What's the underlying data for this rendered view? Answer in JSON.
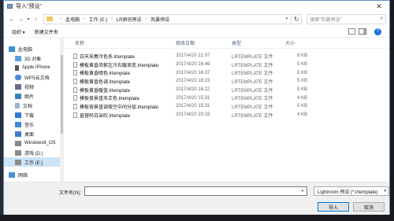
{
  "window": {
    "title": "导入\"预设\"",
    "close_glyph": "✕"
  },
  "address": {
    "crumbs": [
      "此电脑",
      "工作 (E:)",
      "LR原创预设",
      "风暴预设"
    ],
    "search_placeholder": "搜索\"风暴预设\""
  },
  "toolbar": {
    "organize": "组织 ▾",
    "new_folder": "新建文件夹"
  },
  "sidebar": {
    "items": [
      {
        "label": "此电脑"
      },
      {
        "label": "3D 对象"
      },
      {
        "label": "Apple iPhone"
      },
      {
        "label": "WPS云文档"
      },
      {
        "label": "视频"
      },
      {
        "label": "图片"
      },
      {
        "label": "文档"
      },
      {
        "label": "下载"
      },
      {
        "label": "音乐"
      },
      {
        "label": "桌面"
      },
      {
        "label": "Windows8_OS"
      },
      {
        "label": "游戏 (D:)"
      },
      {
        "label": "工作 (E:)"
      },
      {
        "label": "网络"
      }
    ]
  },
  "columns": {
    "name": "名称",
    "date": "修改日期",
    "type": "类型",
    "size": "大小"
  },
  "files": [
    {
      "name": "白天采春冷色系.lrtemplate",
      "date": "2017/4/20 21:07",
      "type": "LRTEMPLATE 文件",
      "size": "8 KB"
    },
    {
      "name": "模板黄昏浓郁左冷右暖渐变.lrtemplate",
      "date": "2017/4/20 16:49",
      "type": "LRTEMPLATE 文件",
      "size": "5 KB"
    },
    {
      "name": "模板黄昏暗色.lrtemplate",
      "date": "2017/4/20 16:37",
      "type": "LRTEMPLATE 文件",
      "size": "5 KB"
    },
    {
      "name": "模板黄昏色调.lrtemplate",
      "date": "2017/4/20 16:23",
      "type": "LRTEMPLATE 文件",
      "size": "5 KB"
    },
    {
      "name": "模板黄昏暖蓝.lrtemplate",
      "date": "2017/4/20 16:22",
      "type": "LRTEMPLATE 文件",
      "size": "5 KB"
    },
    {
      "name": "模板夜景蓝天正色.lrtemplate",
      "date": "2017/4/20 15:31",
      "type": "LRTEMPLATE 文件",
      "size": "4 KB"
    },
    {
      "name": "模板夜景蓝调夜空中间分层.lrtemplate",
      "date": "2017/4/20 15:31",
      "type": "LRTEMPLATE 文件",
      "size": "5 KB"
    },
    {
      "name": "直营码日出吹.lrtemplate",
      "date": "2017/4/20 20:19",
      "type": "LRTEMPLATE 文件",
      "size": "4 KB"
    }
  ],
  "footer": {
    "filename_label": "文件名(N):",
    "filename_value": "",
    "filter": "Lightroom 预设 (*.lrtemplate)",
    "open_button": "导入",
    "cancel_button": "取消"
  },
  "colors": {
    "selection": "#cce4f7",
    "accent": "#0078d7",
    "folder": "#f1c75b"
  }
}
